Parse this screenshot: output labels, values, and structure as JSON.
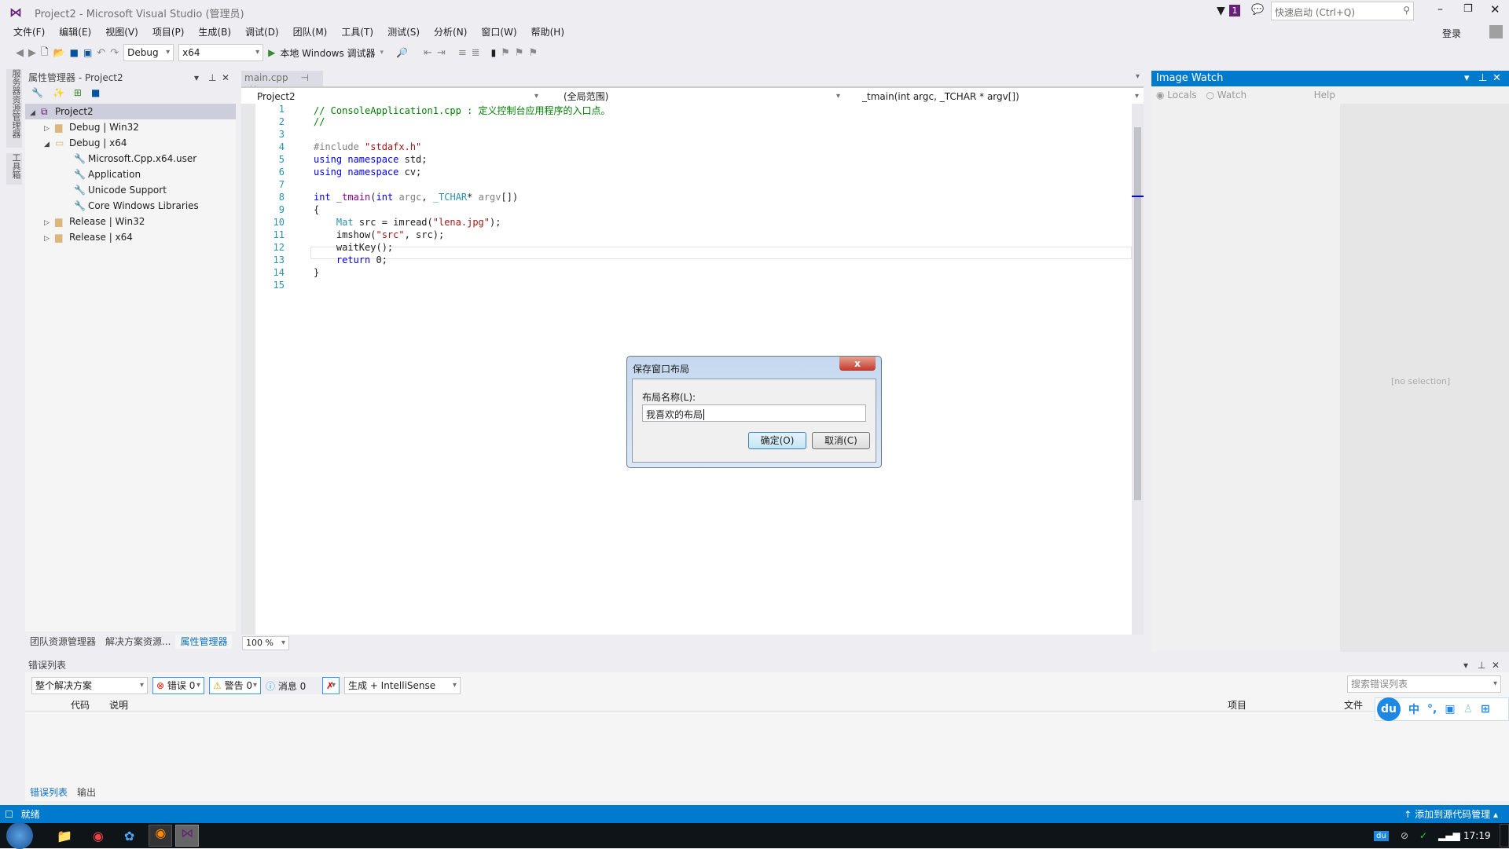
{
  "window": {
    "title": "Project2 - Microsoft Visual Studio (管理员)",
    "quick_launch_placeholder": "快速启动 (Ctrl+Q)",
    "notification_count": "1",
    "sign_in": "登录"
  },
  "menu": [
    "文件(F)",
    "编辑(E)",
    "视图(V)",
    "项目(P)",
    "生成(B)",
    "调试(D)",
    "团队(M)",
    "工具(T)",
    "测试(S)",
    "分析(N)",
    "窗口(W)",
    "帮助(H)"
  ],
  "toolbar": {
    "config": "Debug",
    "platform": "x64",
    "run_label": "本地 Windows 调试器"
  },
  "side_strip": [
    "服务器资源管理器",
    "工具箱"
  ],
  "property_manager": {
    "title": "属性管理器 - Project2",
    "tree": [
      {
        "label": "Project2",
        "level": 0,
        "expanded": true,
        "selected": true,
        "icon": "project-icon"
      },
      {
        "label": "Debug | Win32",
        "level": 1,
        "expanded": false,
        "icon": "folder-icon"
      },
      {
        "label": "Debug | x64",
        "level": 1,
        "expanded": true,
        "icon": "folder-open-icon"
      },
      {
        "label": "Microsoft.Cpp.x64.user",
        "level": 2,
        "icon": "wrench-icon"
      },
      {
        "label": "Application",
        "level": 2,
        "icon": "wrench-icon"
      },
      {
        "label": "Unicode Support",
        "level": 2,
        "icon": "wrench-icon"
      },
      {
        "label": "Core Windows Libraries",
        "level": 2,
        "icon": "wrench-icon"
      },
      {
        "label": "Release | Win32",
        "level": 1,
        "expanded": false,
        "icon": "folder-icon"
      },
      {
        "label": "Release | x64",
        "level": 1,
        "expanded": false,
        "icon": "folder-icon"
      }
    ],
    "bottom_tabs": [
      "团队资源管理器",
      "解决方案资源...",
      "属性管理器"
    ],
    "active_tab": 2
  },
  "editor": {
    "tab": "main.cpp",
    "nav_project": "Project2",
    "nav_scope": "(全局范围)",
    "nav_member": "_tmain(int argc, _TCHAR * argv[])",
    "zoom": "100 %",
    "lines": [
      "1",
      "2",
      "3",
      "4",
      "5",
      "6",
      "7",
      "8",
      "9",
      "10",
      "11",
      "12",
      "13",
      "14",
      "15"
    ]
  },
  "image_watch": {
    "title": "Image Watch",
    "radio_locals": "Locals",
    "radio_watch": "Watch",
    "help": "Help",
    "empty": "[no selection]"
  },
  "error_list": {
    "title": "错误列表",
    "scope": "整个解决方案",
    "errors": "错误 0",
    "warnings": "警告 0",
    "messages": "消息 0",
    "source": "生成 + IntelliSense",
    "search_placeholder": "搜索错误列表",
    "columns": [
      "代码",
      "说明",
      "项目",
      "文件"
    ],
    "bottom_tabs": [
      "错误列表",
      "输出"
    ]
  },
  "dialog": {
    "title": "保存窗口布局",
    "label": "布局名称(L):",
    "value": "我喜欢的布局",
    "ok": "确定(O)",
    "cancel": "取消(C)"
  },
  "status": {
    "text": "就绪",
    "source_control": "添加到源代码管理"
  },
  "ime": {
    "lang": "中",
    "punct": "°,"
  },
  "taskbar": {
    "clock": "17:19"
  },
  "colors": {
    "accent": "#007acc",
    "ime": "#1e88e5",
    "taskbar": "#0f1419"
  }
}
